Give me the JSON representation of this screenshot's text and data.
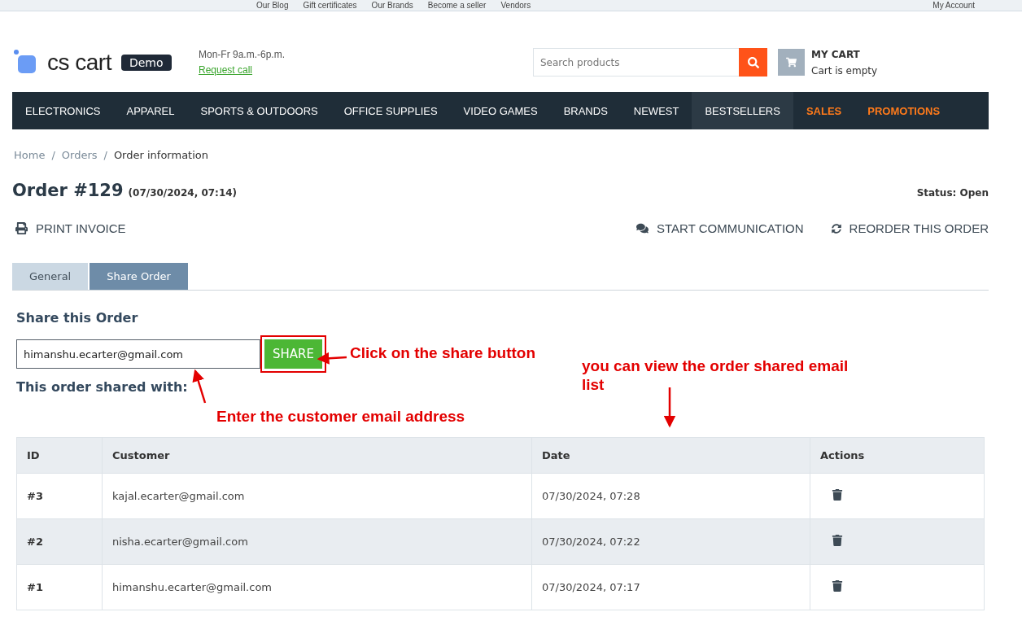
{
  "top_links": [
    "Our Blog",
    "Gift certificates",
    "Our Brands",
    "Become a seller",
    "Vendors"
  ],
  "account": "My Account",
  "logo": {
    "text": "cs cart",
    "badge": "Demo"
  },
  "hours": "Mon-Fr 9a.m.-6p.m.",
  "request_call": "Request call",
  "search": {
    "placeholder": "Search products"
  },
  "cart": {
    "title": "MY CART",
    "status": "Cart is empty"
  },
  "menu": [
    {
      "label": "ELECTRONICS",
      "selected": false,
      "kind": "normal"
    },
    {
      "label": "APPAREL",
      "selected": false,
      "kind": "normal"
    },
    {
      "label": "SPORTS & OUTDOORS",
      "selected": false,
      "kind": "normal"
    },
    {
      "label": "OFFICE SUPPLIES",
      "selected": false,
      "kind": "normal"
    },
    {
      "label": "VIDEO GAMES",
      "selected": false,
      "kind": "normal"
    },
    {
      "label": "BRANDS",
      "selected": false,
      "kind": "normal"
    },
    {
      "label": "NEWEST",
      "selected": false,
      "kind": "normal"
    },
    {
      "label": "BESTSELLERS",
      "selected": true,
      "kind": "normal"
    },
    {
      "label": "SALES",
      "selected": false,
      "kind": "promo"
    },
    {
      "label": "PROMOTIONS",
      "selected": false,
      "kind": "promo"
    }
  ],
  "breadcrumbs": [
    "Home",
    "Orders",
    "Order information"
  ],
  "breadcrumb_separators": [
    "/",
    "/"
  ],
  "order": {
    "title": "Order #129",
    "date": "(07/30/2024, 07:14)",
    "status": "Status: Open"
  },
  "actions": {
    "print": "PRINT INVOICE",
    "communicate": "START COMMUNICATION",
    "reorder": "REORDER THIS ORDER"
  },
  "tabs": [
    {
      "label": "General",
      "selected": false
    },
    {
      "label": "Share Order",
      "selected": true
    }
  ],
  "share": {
    "heading": "Share this Order",
    "value": "himanshu.ecarter@gmail.com",
    "button": "SHARE",
    "shared_with": "This order shared with:"
  },
  "annotations": [
    "Click on the share button",
    "Enter the customer email address",
    "you can view the order shared email list"
  ],
  "table": {
    "columns": [
      "ID",
      "Customer",
      "Date",
      "Actions"
    ],
    "rows": [
      {
        "id": "#3",
        "customer": "kajal.ecarter@gmail.com",
        "date": "07/30/2024, 07:28"
      },
      {
        "id": "#2",
        "customer": "nisha.ecarter@gmail.com",
        "date": "07/30/2024, 07:22"
      },
      {
        "id": "#1",
        "customer": "himanshu.ecarter@gmail.com",
        "date": "07/30/2024, 07:17"
      }
    ]
  }
}
